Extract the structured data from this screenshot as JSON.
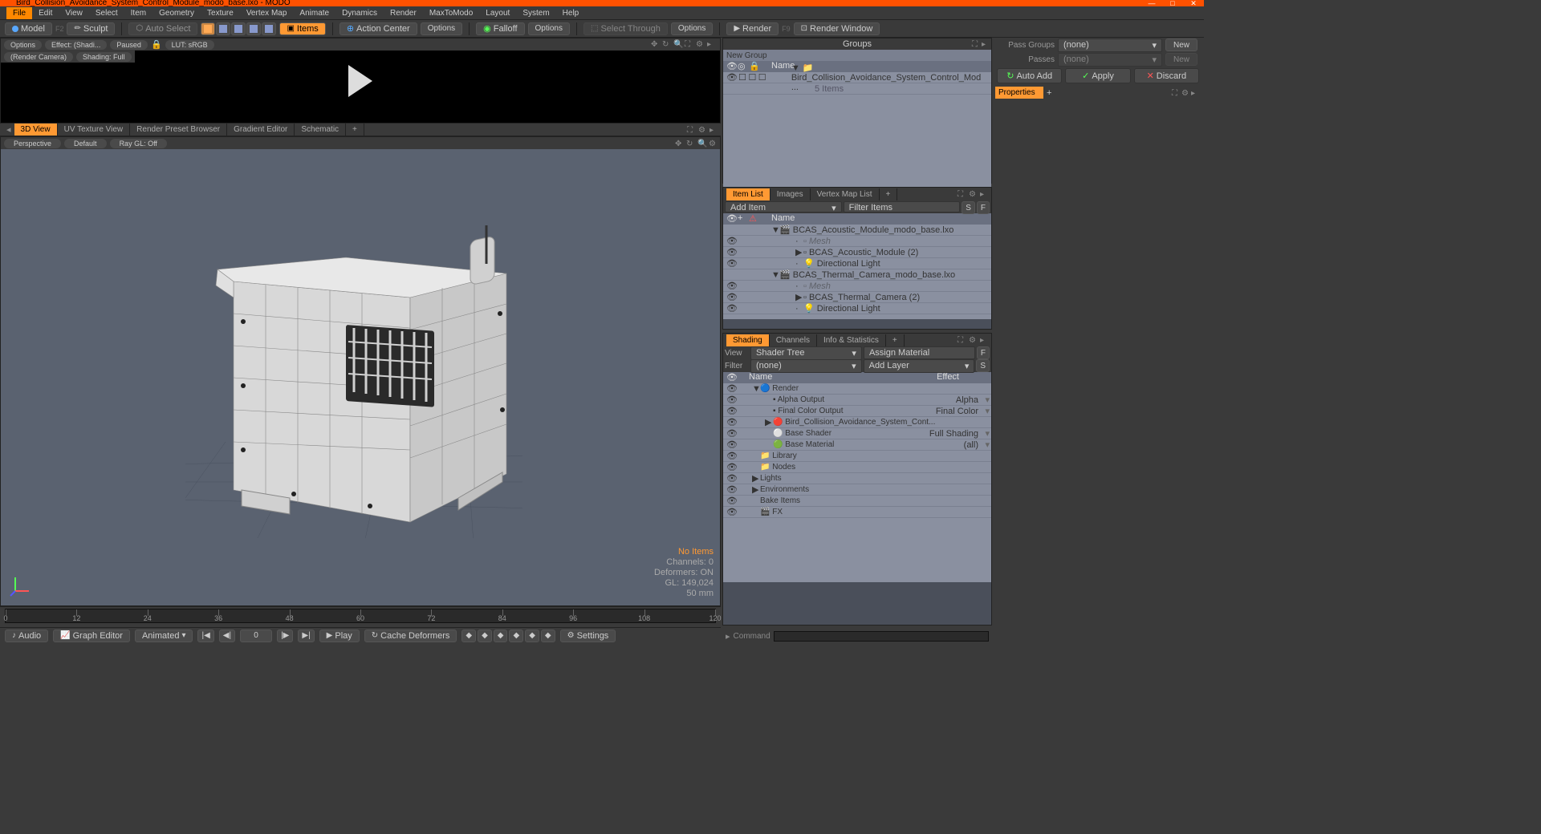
{
  "title": "Bird_Collision_Avoidance_System_Control_Module_modo_base.lxo - MODO",
  "menus": [
    "File",
    "Edit",
    "View",
    "Select",
    "Item",
    "Geometry",
    "Texture",
    "Vertex Map",
    "Animate",
    "Dynamics",
    "Render",
    "MaxToModo",
    "Layout",
    "System",
    "Help"
  ],
  "toolbar": {
    "model": "Model",
    "f2": "F2",
    "sculpt": "Sculpt",
    "auto_select": "Auto Select",
    "items": "Items",
    "action_center": "Action Center",
    "options1": "Options",
    "falloff": "Falloff",
    "options2": "Options",
    "select_through": "Select Through",
    "options3": "Options",
    "render": "Render",
    "f9": "F9",
    "render_window": "Render Window"
  },
  "preview": {
    "options": "Options",
    "effect": "Effect: (Shadi...",
    "paused": "Paused",
    "lut": "LUT: sRGB",
    "render_camera": "(Render Camera)",
    "shading_full": "Shading: Full"
  },
  "view_tabs": [
    "3D View",
    "UV Texture View",
    "Render Preset Browser",
    "Gradient Editor",
    "Schematic"
  ],
  "viewport": {
    "perspective": "Perspective",
    "default": "Default",
    "raygl": "Ray GL: Off",
    "no_items": "No Items",
    "channels": "Channels: 0",
    "deformers": "Deformers: ON",
    "gl": "GL: 149,024",
    "mm": "50 mm"
  },
  "groups": {
    "title": "Groups",
    "new_group": "New Group",
    "name_col": "Name",
    "item": "Bird_Collision_Avoidance_System_Control_Mod ...",
    "subitems": "5 Items"
  },
  "itemlist": {
    "tabs": [
      "Item List",
      "Images",
      "Vertex Map List"
    ],
    "add_item": "Add Item",
    "filter_items": "Filter Items",
    "name_col": "Name",
    "items": [
      {
        "label": "BCAS_Acoustic_Module_modo_base.lxo",
        "indent": 0,
        "arrow": "▼",
        "type": "scene"
      },
      {
        "label": "Mesh",
        "indent": 1,
        "arrow": "",
        "type": "mesh",
        "dim": true
      },
      {
        "label": "BCAS_Acoustic_Module (2)",
        "indent": 1,
        "arrow": "▶",
        "type": "mesh"
      },
      {
        "label": "Directional Light",
        "indent": 1,
        "arrow": "",
        "type": "light"
      },
      {
        "label": "BCAS_Thermal_Camera_modo_base.lxo",
        "indent": 0,
        "arrow": "▼",
        "type": "scene"
      },
      {
        "label": "Mesh",
        "indent": 1,
        "arrow": "",
        "type": "mesh",
        "dim": true
      },
      {
        "label": "BCAS_Thermal_Camera (2)",
        "indent": 1,
        "arrow": "▶",
        "type": "mesh"
      },
      {
        "label": "Directional Light",
        "indent": 1,
        "arrow": "",
        "type": "light"
      }
    ]
  },
  "shading": {
    "tabs": [
      "Shading",
      "Channels",
      "Info & Statistics"
    ],
    "view": "View",
    "shader_tree": "Shader Tree",
    "assign_material": "Assign Material",
    "filter": "Filter",
    "none": "(none)",
    "add_layer": "Add Layer",
    "name_col": "Name",
    "effect_col": "Effect",
    "rows": [
      {
        "label": "Render",
        "effect": "",
        "indent": 0,
        "arrow": "▼",
        "icon": "render"
      },
      {
        "label": "Alpha Output",
        "effect": "Alpha",
        "indent": 1,
        "icon": "output"
      },
      {
        "label": "Final Color Output",
        "effect": "Final Color",
        "indent": 1,
        "icon": "output"
      },
      {
        "label": "Bird_Collision_Avoidance_System_Cont...",
        "effect": "",
        "indent": 1,
        "arrow": "▶",
        "icon": "mat"
      },
      {
        "label": "Base Shader",
        "effect": "Full Shading",
        "indent": 1,
        "icon": "shader"
      },
      {
        "label": "Base Material",
        "effect": "(all)",
        "indent": 1,
        "icon": "material"
      },
      {
        "label": "Library",
        "effect": "",
        "indent": 0,
        "icon": "folder"
      },
      {
        "label": "Nodes",
        "effect": "",
        "indent": 0,
        "icon": "folder"
      },
      {
        "label": "Lights",
        "effect": "",
        "indent": 0,
        "arrow": "▶"
      },
      {
        "label": "Environments",
        "effect": "",
        "indent": 0,
        "arrow": "▶"
      },
      {
        "label": "Bake Items",
        "effect": "",
        "indent": 0
      },
      {
        "label": "FX",
        "effect": "",
        "indent": 0,
        "icon": "fx"
      }
    ]
  },
  "far": {
    "pass_groups": "Pass Groups",
    "passes": "Passes",
    "none": "(none)",
    "new": "New",
    "auto_add": "Auto Add",
    "apply": "Apply",
    "discard": "Discard",
    "properties": "Properties"
  },
  "timeline": {
    "ticks": [
      "0",
      "12",
      "24",
      "36",
      "48",
      "60",
      "72",
      "84",
      "96",
      "108",
      "120"
    ],
    "start": "0",
    "end": "120"
  },
  "bottom": {
    "audio": "Audio",
    "graph_editor": "Graph Editor",
    "animated": "Animated",
    "frame": "0",
    "play": "Play",
    "cache_deformers": "Cache Deformers",
    "settings": "Settings",
    "command": "Command"
  }
}
